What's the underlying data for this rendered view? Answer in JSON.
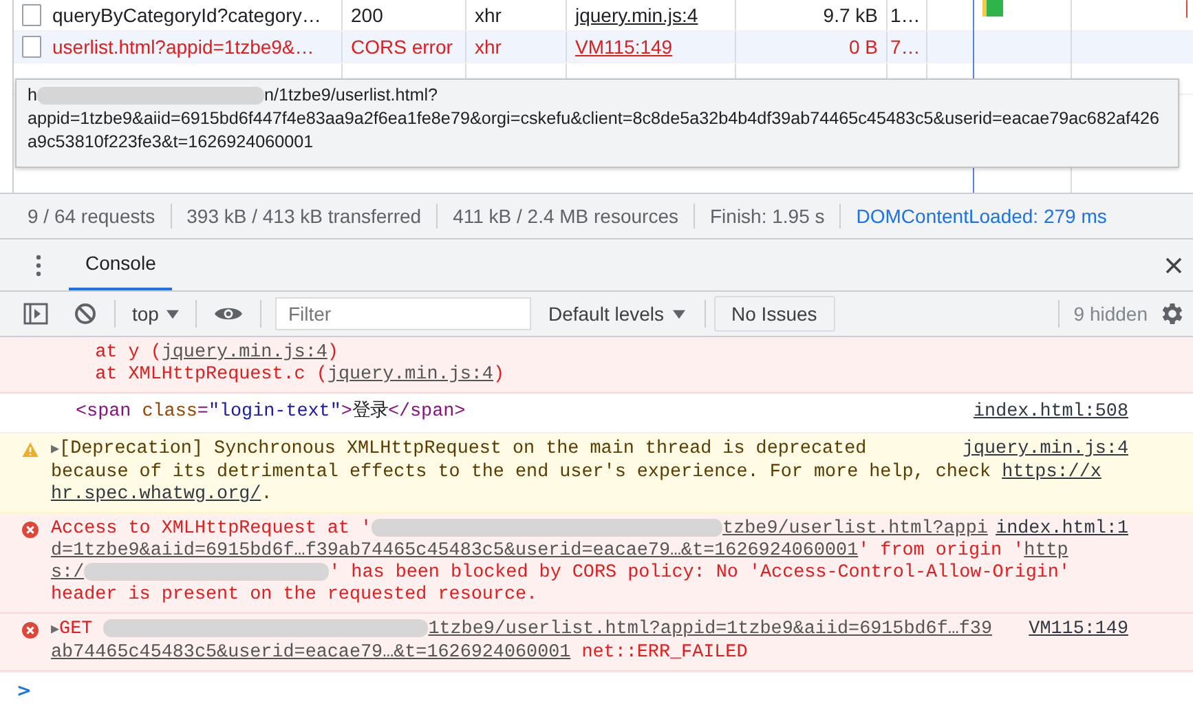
{
  "network": {
    "rows": [
      {
        "name": "queryByCategoryId?category…",
        "status": "200",
        "type": "xhr",
        "initiator": "jquery.min.js:4",
        "size": "9.7 kB",
        "time": "1…",
        "selected": false,
        "error": false
      },
      {
        "name": "userlist.html?appid=1tzbe9&…",
        "status": "CORS error",
        "type": "xhr",
        "initiator": "VM115:149",
        "size": "0 B",
        "time": "7…",
        "selected": true,
        "error": true
      }
    ],
    "tooltip": [
      [
        {
          "kind": "text",
          "text": "h"
        },
        {
          "kind": "redacted"
        },
        {
          "kind": "text",
          "text": "n/1tzbe9/userlist.html?"
        }
      ],
      [
        {
          "kind": "text",
          "text": "appid=1tzbe9&aiid=6915bd6f447f4e83aa9a2f6ea1fe8e79&orgi=cskefu&client=8c8de5a32b4b4df39ab74465c45483c5&userid=eacae79ac682af426a9c53810f223fe3&t=1626924060001"
        }
      ]
    ]
  },
  "status_bar": [
    {
      "text": "9 / 64 requests",
      "highlight": false
    },
    {
      "text": "393 kB / 413 kB transferred",
      "highlight": false
    },
    {
      "text": "411 kB / 2.4 MB resources",
      "highlight": false
    },
    {
      "text": "Finish: 1.95 s",
      "highlight": false
    },
    {
      "text": "DOMContentLoaded: 279 ms",
      "highlight": true
    }
  ],
  "drawer": {
    "tabs": [
      {
        "label": "Console",
        "selected": true
      }
    ]
  },
  "toolbar": {
    "context": "top",
    "filter_placeholder": "Filter",
    "levels": "Default levels",
    "issues": "No Issues",
    "hidden_count": "9 hidden"
  },
  "messages": [
    {
      "kind": "trace",
      "lines": [
        [
          {
            "kind": "text",
            "text": "    at y ("
          },
          {
            "kind": "link",
            "text": "jquery.min.js:4"
          },
          {
            "kind": "text",
            "text": ")"
          }
        ],
        [
          {
            "kind": "text",
            "text": "    at XMLHttpRequest.c ("
          },
          {
            "kind": "link",
            "text": "jquery.min.js:4"
          },
          {
            "kind": "text",
            "text": ")"
          }
        ]
      ]
    },
    {
      "kind": "log",
      "source": "index.html:508",
      "lines": [
        [
          {
            "kind": "tag",
            "text": "<span "
          },
          {
            "kind": "attr",
            "text": "class"
          },
          {
            "kind": "tag",
            "text": "="
          },
          {
            "kind": "value",
            "text": "\"login-text\""
          },
          {
            "kind": "tag",
            "text": ">"
          },
          {
            "kind": "text",
            "text": "登录"
          },
          {
            "kind": "tag",
            "text": "</span>"
          }
        ]
      ]
    },
    {
      "kind": "warning",
      "source": "jquery.min.js:4",
      "lines": [
        [
          {
            "kind": "expand",
            "text": "▶"
          },
          {
            "kind": "text",
            "text": "[Deprecation] Synchronous XMLHttpRequest on the main thread is deprecated"
          }
        ],
        [
          {
            "kind": "text",
            "text": "because of its detrimental effects to the end user's experience. For more help, check "
          },
          {
            "kind": "link",
            "text": "https://x"
          }
        ],
        [
          {
            "kind": "link",
            "text": "hr.spec.whatwg.org/"
          },
          {
            "kind": "text",
            "text": "."
          }
        ]
      ]
    },
    {
      "kind": "error",
      "source": "index.html:1",
      "lines": [
        [
          {
            "kind": "text",
            "text": "Access to XMLHttpRequest at '"
          },
          {
            "kind": "redacted"
          },
          {
            "kind": "link",
            "text": "tzbe9/userlist.html?appi"
          }
        ],
        [
          {
            "kind": "link",
            "text": "d=1tzbe9&aiid=6915bd6f…f39ab74465c45483c5&userid=eacae79…&t=1626924060001"
          },
          {
            "kind": "text",
            "text": "' from origin '"
          },
          {
            "kind": "link",
            "text": "http"
          }
        ],
        [
          {
            "kind": "link",
            "text": "s:/"
          },
          {
            "kind": "redacted"
          },
          {
            "kind": "text",
            "text": "' has been blocked by CORS policy: No 'Access-Control-Allow-Origin'"
          }
        ],
        [
          {
            "kind": "text",
            "text": "header is present on the requested resource."
          }
        ]
      ]
    },
    {
      "kind": "error",
      "source": "VM115:149",
      "lines": [
        [
          {
            "kind": "expand",
            "text": "▶"
          },
          {
            "kind": "text",
            "text": "GET "
          },
          {
            "kind": "redacted"
          },
          {
            "kind": "link",
            "text": "1tzbe9/userlist.html?appid=1tzbe9&aiid=6915bd6f…f39"
          }
        ],
        [
          {
            "kind": "link",
            "text": "ab74465c45483c5&userid=eacae79…&t=1626924060001"
          },
          {
            "kind": "text",
            "text": " net::ERR_FAILED"
          }
        ]
      ]
    }
  ],
  "prompt": ">"
}
